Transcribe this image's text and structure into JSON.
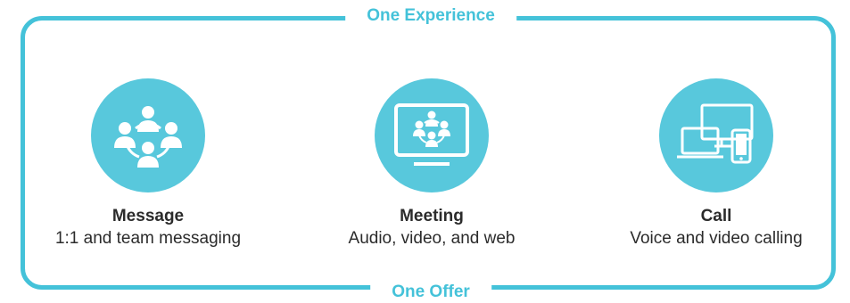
{
  "frame": {
    "top_label": "One Experience",
    "bottom_label": "One Offer",
    "accent_color": "#44c2d9"
  },
  "features": [
    {
      "icon": "people-network-icon",
      "title": "Message",
      "subtitle": "1:1 and team messaging"
    },
    {
      "icon": "video-meeting-icon",
      "title": "Meeting",
      "subtitle": "Audio, video, and web"
    },
    {
      "icon": "devices-icon",
      "title": "Call",
      "subtitle": "Voice and video calling"
    }
  ]
}
